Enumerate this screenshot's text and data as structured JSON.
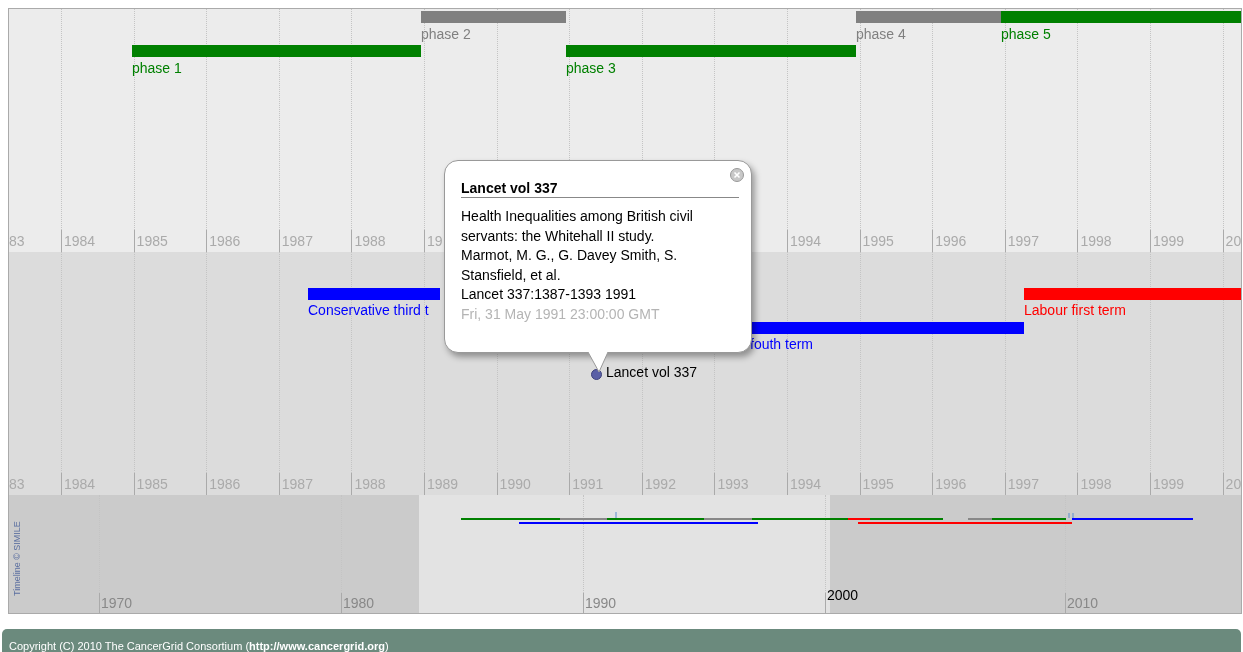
{
  "phase_band": {
    "events": [
      {
        "label": "phase 1",
        "color": "#008000"
      },
      {
        "label": "phase 2",
        "color": "#808080"
      },
      {
        "label": "phase 3",
        "color": "#008000"
      },
      {
        "label": "phase 4",
        "color": "#808080"
      },
      {
        "label": "phase 5",
        "color": "#008000"
      }
    ],
    "scale_labels": [
      "83",
      "1984",
      "1985",
      "1986",
      "1987",
      "1988",
      "19",
      "1994",
      "1995",
      "1996",
      "1997",
      "1998",
      "1999",
      "20"
    ]
  },
  "term_band": {
    "events": [
      {
        "kind": "span",
        "label": "Conservative third t",
        "color": "#0000ff"
      },
      {
        "kind": "span",
        "label": "fouth term",
        "color": "#0000ff"
      },
      {
        "kind": "span",
        "label": "Labour first term",
        "color": "#ff0000"
      },
      {
        "kind": "point",
        "label": "Lancet vol 337",
        "color": "#5a5fa6"
      }
    ],
    "scale_labels": [
      "83",
      "1984",
      "1985",
      "1986",
      "1987",
      "1988",
      "1989",
      "1990",
      "1991",
      "1992",
      "1993",
      "1994",
      "1995",
      "1996",
      "1997",
      "1998",
      "1999",
      "20"
    ]
  },
  "overview_band": {
    "credit": "Timeline © SIMILE",
    "scale_labels": [
      {
        "label": "1970",
        "kind": "tick"
      },
      {
        "label": "1980",
        "kind": "tick"
      },
      {
        "label": "1990",
        "kind": "tick"
      },
      {
        "label": "2000",
        "kind": "center"
      },
      {
        "label": "2010",
        "kind": "tick"
      }
    ]
  },
  "popup": {
    "title": "Lancet vol 337",
    "description": "Health Inequalities among British civil servants: the Whitehall II study.",
    "authors": "Marmot, M. G., G. Davey Smith, S. Stansfield, et al.",
    "citation": "Lancet 337:1387-1393 1991",
    "date": "Fri, 31 May 1991 23:00:00 GMT"
  },
  "footer": {
    "text": "Copyright (C) 2010 The CancerGrid Consortium (**http://www.cancergrid.org**)"
  }
}
